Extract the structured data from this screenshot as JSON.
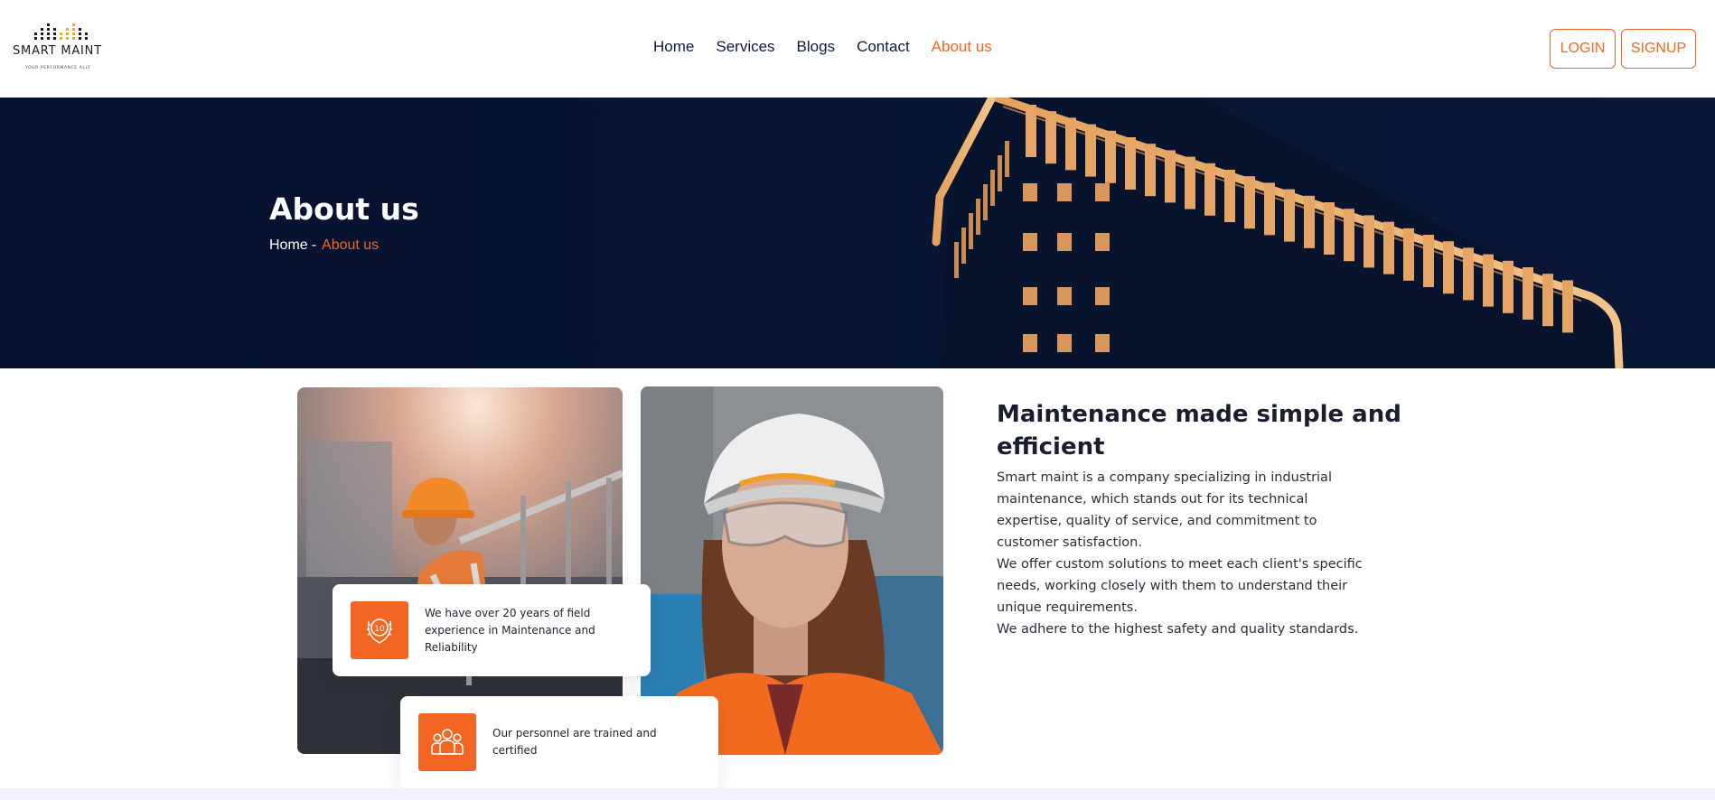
{
  "header": {
    "logo": {
      "name": "SMART MAINT",
      "tagline": "YOUR PERFORMANCE ALLY",
      "dot_colors": [
        "#1b1b1b",
        "#f5a623"
      ]
    },
    "nav": [
      {
        "label": "Home",
        "active": false
      },
      {
        "label": "Services",
        "active": false
      },
      {
        "label": "Blogs",
        "active": false
      },
      {
        "label": "Contact",
        "active": false
      },
      {
        "label": "About us",
        "active": true
      }
    ],
    "login_label": "LOGIN",
    "signup_label": "SIGNUP"
  },
  "hero": {
    "title": "About us",
    "breadcrumb": {
      "home": "Home",
      "separator": "-",
      "current": "About us"
    }
  },
  "features": [
    {
      "icon": "award-10-years-icon",
      "text": "We have over 20 years of field experience in Maintenance and Reliability"
    },
    {
      "icon": "team-people-icon",
      "text": "Our personnel are trained and certified"
    }
  ],
  "about": {
    "heading": "Maintenance made simple and efficient",
    "paragraphs": [
      "Smart maint is a company specializing in industrial maintenance, which stands out for its technical expertise, quality of service, and commitment to customer satisfaction.",
      "We offer custom solutions to meet each client's specific needs, working closely with them to understand their unique requirements.",
      "We adhere to the highest safety and quality standards."
    ]
  },
  "colors": {
    "accent": "#f26522",
    "navy": "#06122f",
    "nav_text": "#0f1a3e"
  }
}
